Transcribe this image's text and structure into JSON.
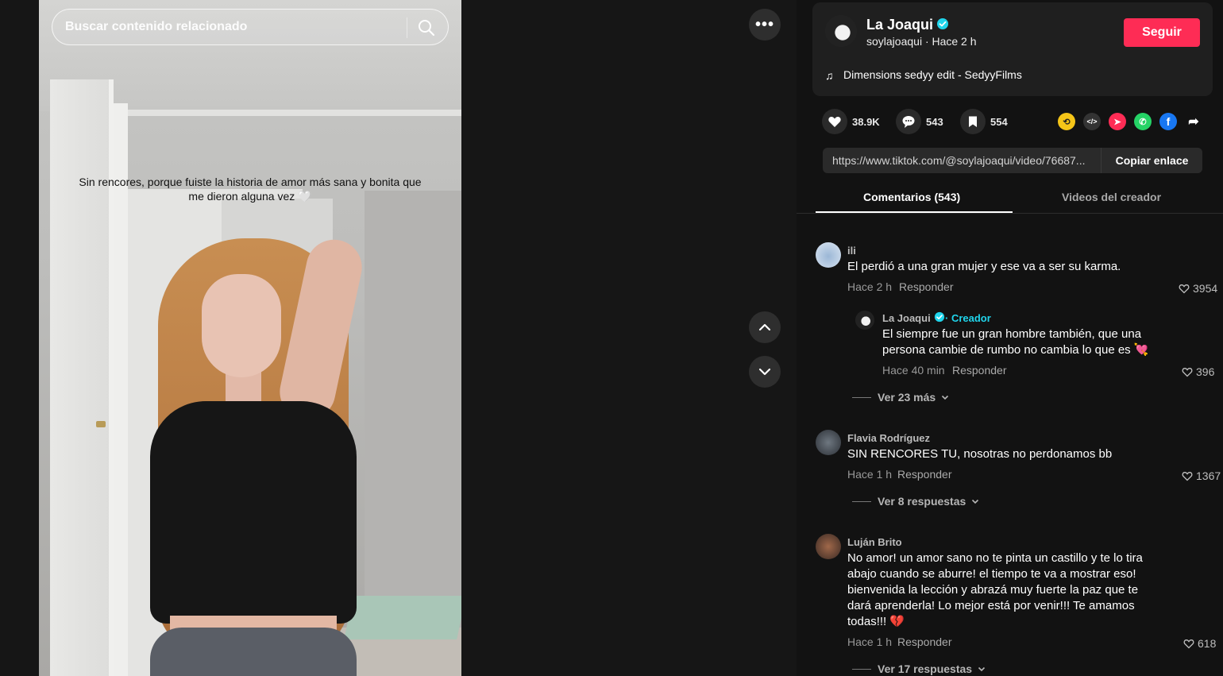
{
  "search": {
    "placeholder": "Buscar contenido relacionado"
  },
  "video": {
    "caption": "Sin rencores, porque fuiste la historia de amor más sana y bonita que me dieron alguna vez 🤍"
  },
  "creator": {
    "name": "La Joaqui",
    "handle_meta": "soylajoaqui · Hace 2 h",
    "follow_label": "Seguir",
    "music": "Dimensions sedyy edit - SedyyFilms"
  },
  "stats": {
    "likes": "38.9K",
    "comments": "543",
    "saves": "554"
  },
  "link": {
    "url": "https://www.tiktok.com/@soylajoaqui/video/76687...",
    "copy_label": "Copiar enlace"
  },
  "tabs": {
    "comments": "Comentarios (543)",
    "creator_videos": "Videos del creador"
  },
  "comments": [
    {
      "user": "ili",
      "text": "El perdió a una gran mujer y ese va a ser su karma.",
      "time": "Hace 2 h",
      "reply": "Responder",
      "likes": "3954",
      "sub": {
        "user": "La Joaqui",
        "badge": "· Creador",
        "text": "El siempre fue un gran hombre también, que una persona cambie de rumbo no cambia lo que es 💘",
        "time": "Hace 40 min",
        "reply": "Responder",
        "likes": "396"
      },
      "more": "Ver 23 más"
    },
    {
      "user": "Flavia Rodríguez",
      "text": "SIN RENCORES TU, nosotras no perdonamos bb",
      "time": "Hace 1 h",
      "reply": "Responder",
      "likes": "1367",
      "more": "Ver 8 respuestas"
    },
    {
      "user": "Luján Brito",
      "text": "No amor! un amor sano no te pinta un castillo y te lo tira abajo cuando se aburre! el tiempo te va a mostrar eso! bienvenida la lección y abrazá muy fuerte la paz que te dará aprenderla! Lo mejor está por venir!!! Te amamos todas!!! 💔",
      "time": "Hace 1 h",
      "reply": "Responder",
      "likes": "618",
      "more": "Ver 17 respuestas"
    }
  ],
  "colors": {
    "accent": "#fe2c55",
    "verified": "#20d5ec",
    "panel": "#1f1f1f"
  }
}
